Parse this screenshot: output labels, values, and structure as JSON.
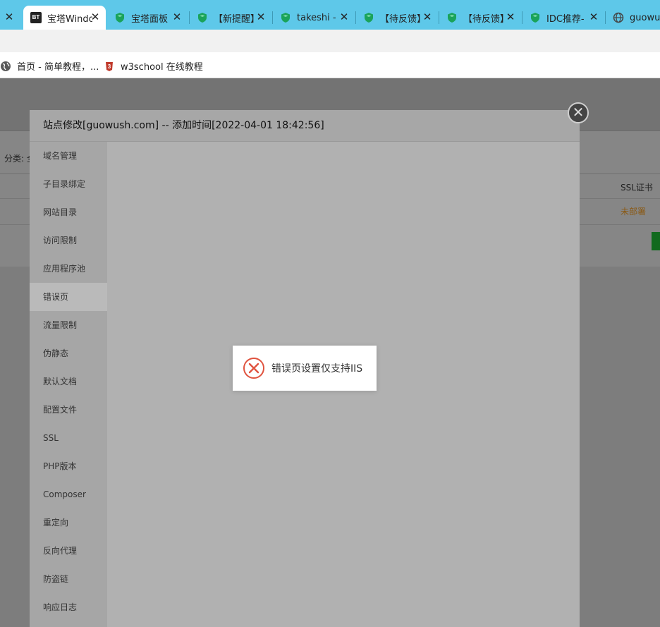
{
  "browser": {
    "tabs": [
      {
        "title": "",
        "favicon": "partial-tab",
        "active": false
      },
      {
        "title": "宝塔Windo",
        "favicon": "bt-logo",
        "active": true
      },
      {
        "title": "宝塔面板",
        "favicon": "green-shield-icon",
        "active": false
      },
      {
        "title": "【新提醒】",
        "favicon": "green-shield-icon",
        "active": false
      },
      {
        "title": "takeshi -",
        "favicon": "green-shield-icon",
        "active": false
      },
      {
        "title": "【待反馈】",
        "favicon": "green-shield-icon",
        "active": false
      },
      {
        "title": "【待反馈】",
        "favicon": "green-shield-icon",
        "active": false
      },
      {
        "title": "IDC推荐-",
        "favicon": "green-shield-icon",
        "active": false
      },
      {
        "title": "guowus",
        "favicon": "globe-icon",
        "active": false
      }
    ],
    "tab_close_glyph": "✕",
    "bookmarks": [
      {
        "label": "首页 - 简单教程，...",
        "icon": "globe-icon"
      },
      {
        "label": "w3school 在线教程",
        "icon": "w3school-icon"
      }
    ],
    "colors": {
      "tabstrip": "#5ec8e9",
      "shield": "#1aa35a"
    }
  },
  "page": {
    "filter_label": "分类: 全",
    "ssl_header": "SSL证书",
    "ssl_value": "未部署"
  },
  "modal": {
    "title": "站点修改[guowush.com] -- 添加时间[2022-04-01 18:42:56]",
    "close_glyph": "✕",
    "menu": [
      "域名管理",
      "子目录绑定",
      "网站目录",
      "访问限制",
      "应用程序池",
      "错误页",
      "流量限制",
      "伪静态",
      "默认文档",
      "配置文件",
      "SSL",
      "PHP版本",
      "Composer",
      "重定向",
      "反向代理",
      "防盗链",
      "响应日志"
    ],
    "active_item": "错误页"
  },
  "toast": {
    "icon": "error-circle-icon",
    "message": "错误页设置仅支持IIS",
    "color": "#e0533f"
  }
}
